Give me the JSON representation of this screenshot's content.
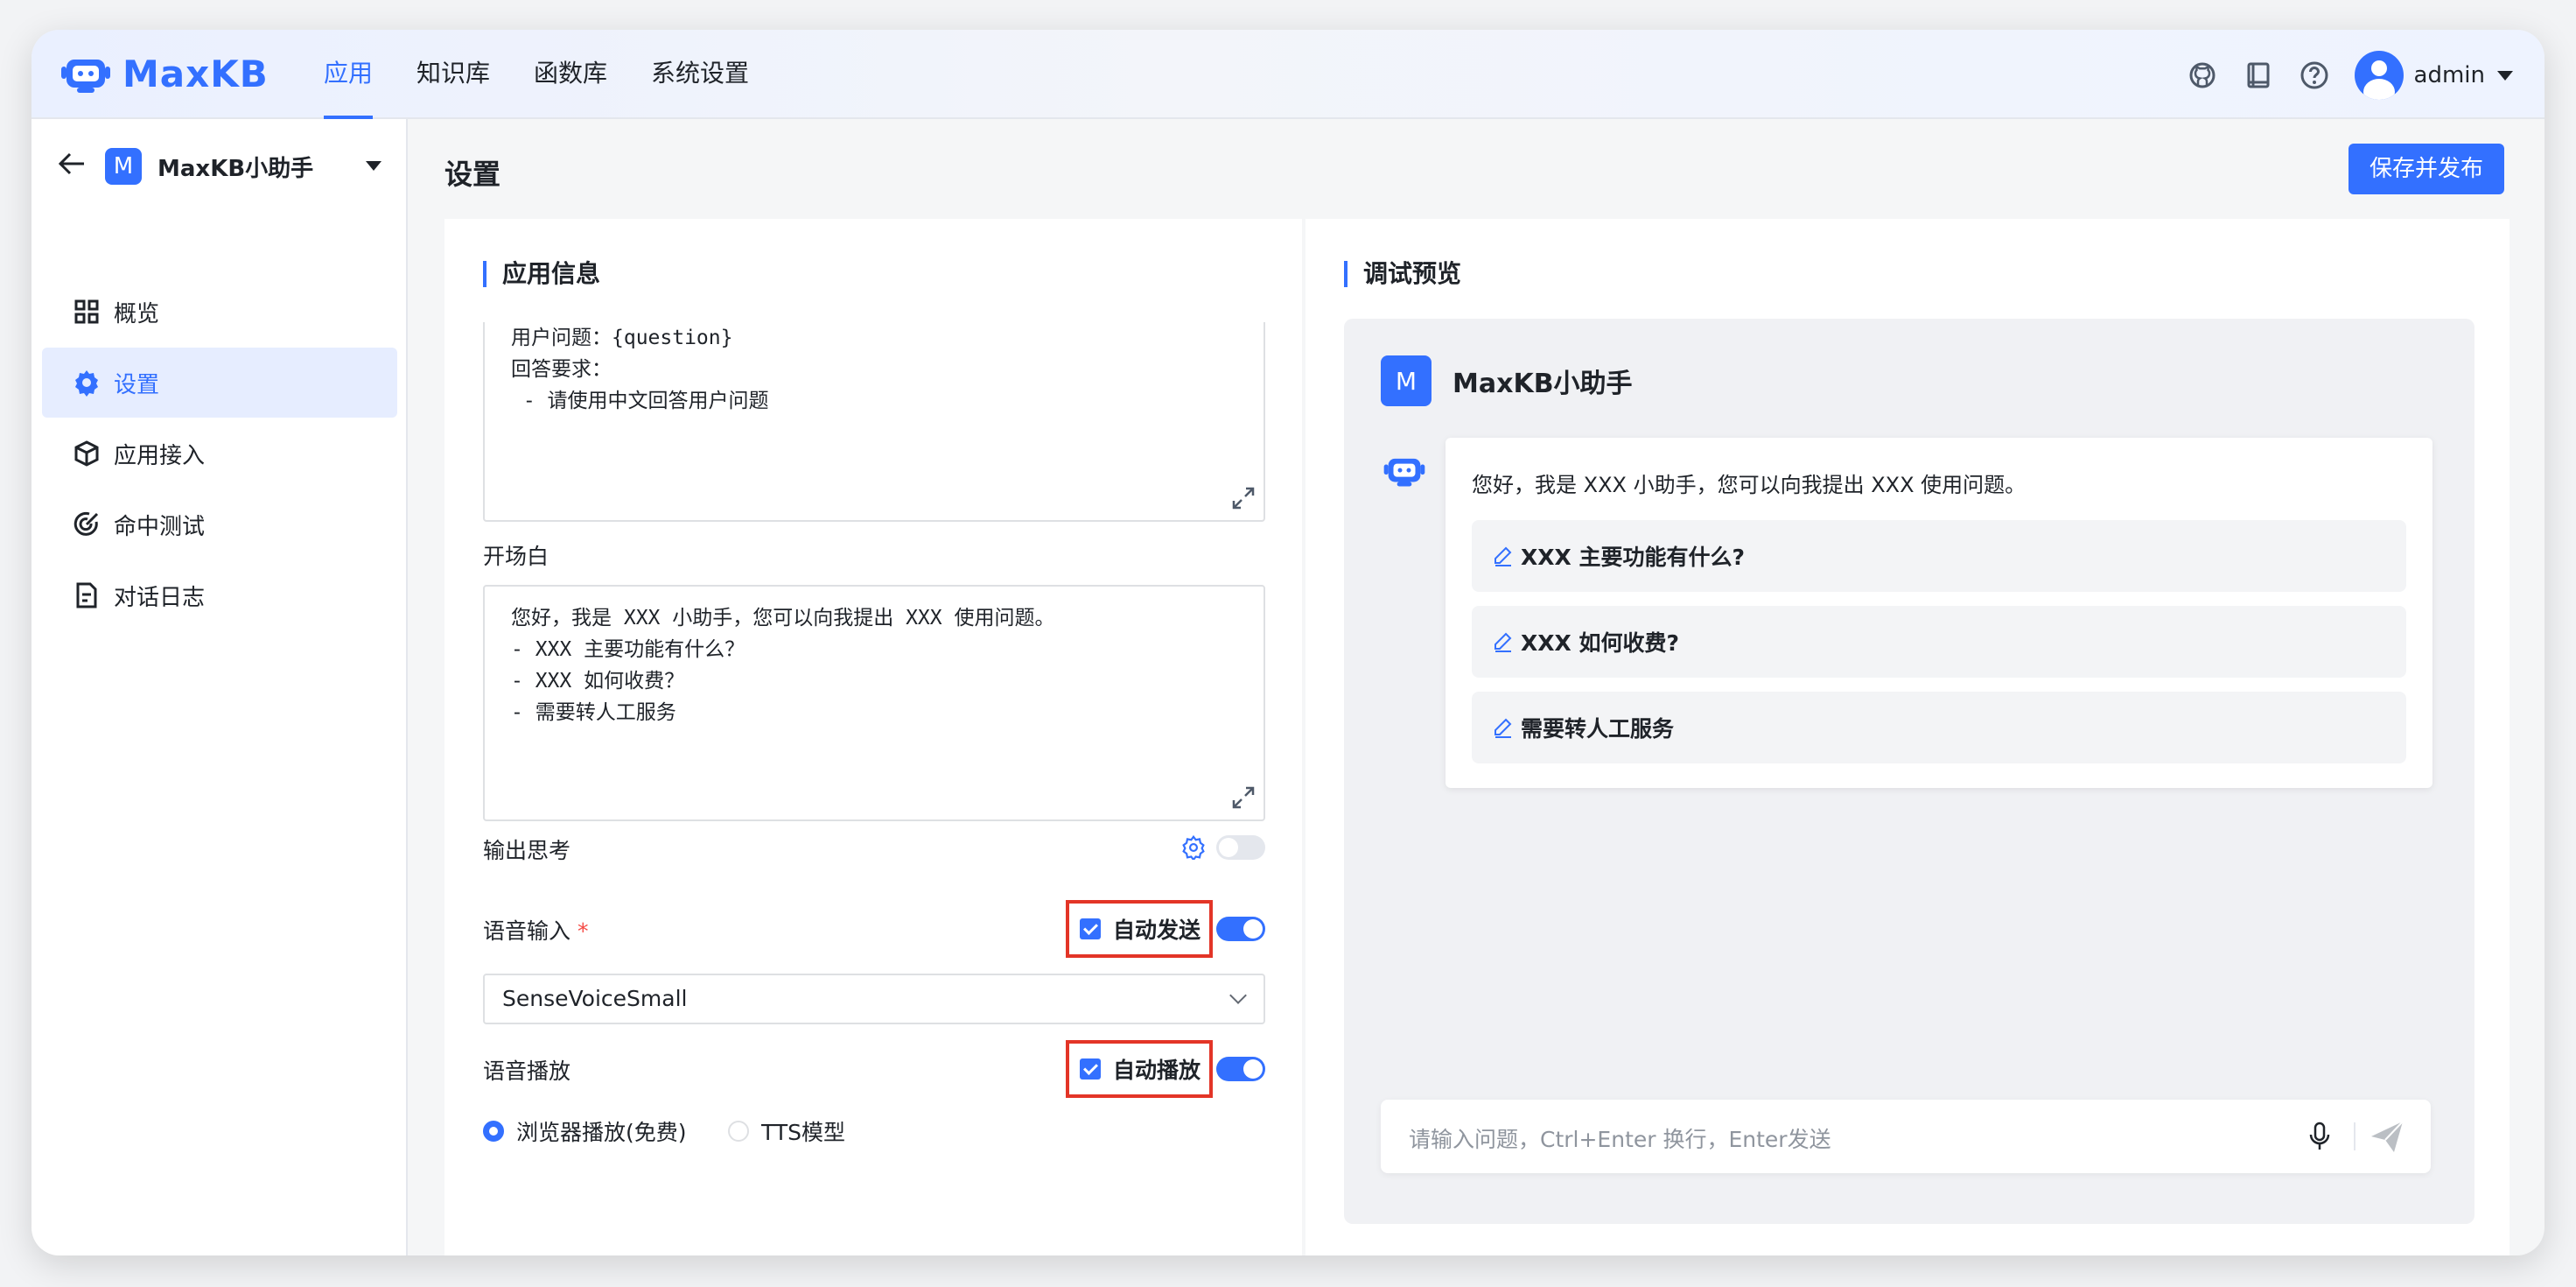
{
  "header": {
    "logo_text": "MaxKB",
    "nav": [
      {
        "label": "应用",
        "active": true
      },
      {
        "label": "知识库",
        "active": false
      },
      {
        "label": "函数库",
        "active": false
      },
      {
        "label": "系统设置",
        "active": false
      }
    ],
    "icons": [
      "github-icon",
      "book-icon",
      "help-icon"
    ],
    "user": "admin"
  },
  "sidebar": {
    "app_badge": "M",
    "app_name": "MaxKB小助手",
    "items": [
      {
        "label": "概览",
        "icon": "grid-icon",
        "active": false
      },
      {
        "label": "设置",
        "icon": "gear-icon",
        "active": true
      },
      {
        "label": "应用接入",
        "icon": "cube-icon",
        "active": false
      },
      {
        "label": "命中测试",
        "icon": "target-icon",
        "active": false
      },
      {
        "label": "对话日志",
        "icon": "document-icon",
        "active": false
      }
    ]
  },
  "main": {
    "title": "设置",
    "publish_label": "保存并发布",
    "app_info": {
      "section_title": "应用信息",
      "prompt_text": "用户问题：{question}\n回答要求：\n - 请使用中文回答用户问题",
      "opening_label": "开场白",
      "opening_text": "您好，我是 XXX 小助手，您可以向我提出 XXX 使用问题。\n- XXX 主要功能有什么？\n- XXX 如何收费？\n- 需要转人工服务",
      "thinking_label": "输出思考",
      "thinking_enabled": false,
      "voice_input_label": "语音输入",
      "voice_input_required_mark": "*",
      "auto_send_label": "自动发送",
      "auto_send_checked": true,
      "voice_input_enabled": true,
      "stt_model": "SenseVoiceSmall",
      "voice_play_label": "语音播放",
      "auto_play_label": "自动播放",
      "auto_play_checked": true,
      "voice_play_enabled": true,
      "play_options": [
        {
          "label": "浏览器播放(免费)",
          "selected": true
        },
        {
          "label": "TTS模型",
          "selected": false
        }
      ]
    },
    "preview": {
      "section_title": "调试预览",
      "app_badge": "M",
      "app_name": "MaxKB小助手",
      "greeting": "您好，我是 XXX 小助手，您可以向我提出 XXX 使用问题。",
      "questions": [
        "XXX 主要功能有什么?",
        "XXX 如何收费?",
        "需要转人工服务"
      ],
      "input_placeholder": "请输入问题，Ctrl+Enter 换行，Enter发送"
    }
  },
  "colors": {
    "accent": "#3370ff",
    "highlight_box": "#e33527"
  }
}
